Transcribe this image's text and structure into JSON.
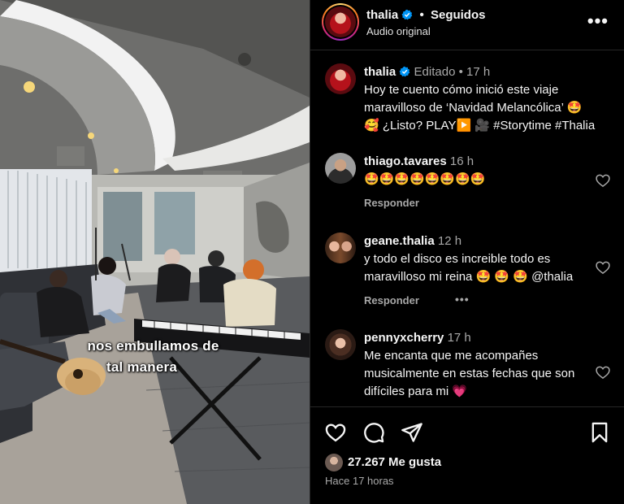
{
  "media": {
    "caption_line1": "nos embullamos de",
    "caption_line2": "tal manera"
  },
  "header": {
    "username": "thalia",
    "separator": "•",
    "follow_status": "Seguidos",
    "audio_label": "Audio original",
    "more_label": "•••"
  },
  "post": {
    "username": "thalia",
    "edited_label": "Editado",
    "separator": "•",
    "time": "17 h",
    "caption_line1": "Hoy te cuento cómo inició este viaje",
    "caption_line2": "maravilloso de ‘Navidad Melancólica’ 🤩",
    "caption_line3": "🥰 ¿Listo? PLAY▶️ 🎥 #Storytime #Thalia"
  },
  "comments": [
    {
      "username": "thiago.tavares",
      "time": "16 h",
      "text": "🤩🤩🤩🤩🤩🤩🤩🤩",
      "reply": "Responder"
    },
    {
      "username": "geane.thalia",
      "time": "12 h",
      "text": "y todo el disco es increible todo es maravilloso mi reina 🤩 🤩 🤩 @thalia",
      "reply": "Responder",
      "more": "•••"
    },
    {
      "username": "pennyxcherry",
      "time": "17 h",
      "text": "Me encanta que me acompañes musicalmente en estas fechas que son difíciles para mi 💗"
    }
  ],
  "footer": {
    "likes": "27.267 Me gusta",
    "posted_ago": "Hace 17 horas"
  },
  "colors": {
    "background": "#000000",
    "text": "#f5f5f5",
    "muted": "#a8a8a8",
    "verified": "#0095f6",
    "divider": "#262626"
  }
}
